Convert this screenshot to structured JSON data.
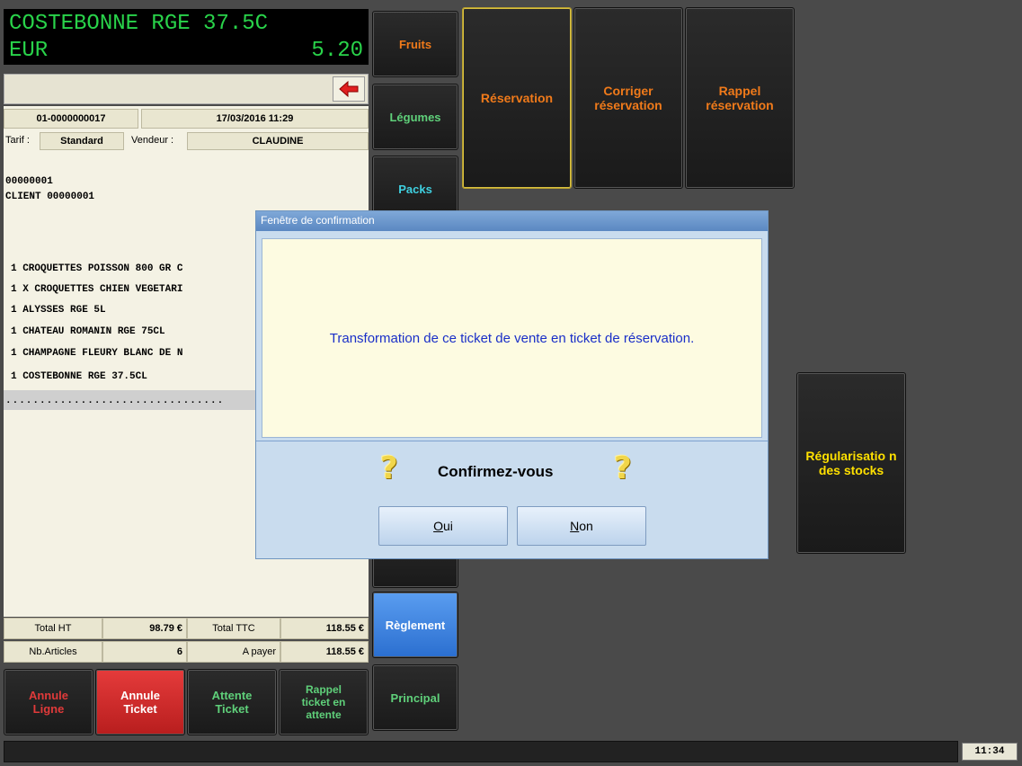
{
  "lcd": {
    "line1": "COSTEBONNE RGE 37.5C",
    "line2_left": "EUR",
    "line2_right": "5.20"
  },
  "ticket": {
    "number": "01-0000000017",
    "datetime": "17/03/2016 11:29",
    "tarif_label": "Tarif :",
    "tarif_value": "Standard",
    "vendeur_label": "Vendeur :",
    "vendeur_value": "CLAUDINE",
    "client_code": "00000001",
    "client_name": "CLIENT 00000001",
    "lines": [
      "1 CROQUETTES POISSON 800 GR C",
      "1 X CROQUETTES CHIEN VEGETARI",
      "1 ALYSSES RGE 5L",
      "1 CHATEAU ROMANIN RGE 75CL",
      "1 CHAMPAGNE FLEURY BLANC DE N",
      "1 COSTEBONNE RGE 37.5CL"
    ],
    "separator": "................................"
  },
  "totals": {
    "total_ht_label": "Total HT",
    "total_ht": "98.79 €",
    "total_ttc_label": "Total TTC",
    "total_ttc": "118.55 €",
    "nb_articles_label": "Nb.Articles",
    "nb_articles": "6",
    "a_payer_label": "A payer",
    "a_payer": "118.55 €"
  },
  "bottom_buttons": {
    "annule_ligne": "Annule Ligne",
    "annule_ticket": "Annule Ticket",
    "attente_ticket": "Attente Ticket",
    "rappel_ticket": "Rappel ticket en attente"
  },
  "categories": {
    "fruits": "Fruits",
    "legumes": "Légumes",
    "packs": "Packs",
    "reglement": "Règlement",
    "principal": "Principal"
  },
  "actions": {
    "reservation": "Réservation",
    "corriger": "Corriger réservation",
    "rappel": "Rappel réservation",
    "regularisation": "Régularisatio n des stocks"
  },
  "dialog": {
    "title": "Fenêtre de confirmation",
    "message": "Transformation de ce ticket de vente en ticket de réservation.",
    "question": "Confirmez-vous",
    "yes": "Oui",
    "yes_accel": "O",
    "yes_rest": "ui",
    "no": "Non",
    "no_accel": "N",
    "no_rest": "on",
    "question_icon": "question-mark-icon"
  },
  "status_bar": {
    "time": "11:34"
  },
  "colors": {
    "orange": "#f07a1a",
    "green": "#5fd07a",
    "yellow": "#ffe000",
    "blue_active": "#3d7fd9",
    "lcd_green": "#29d34a"
  }
}
